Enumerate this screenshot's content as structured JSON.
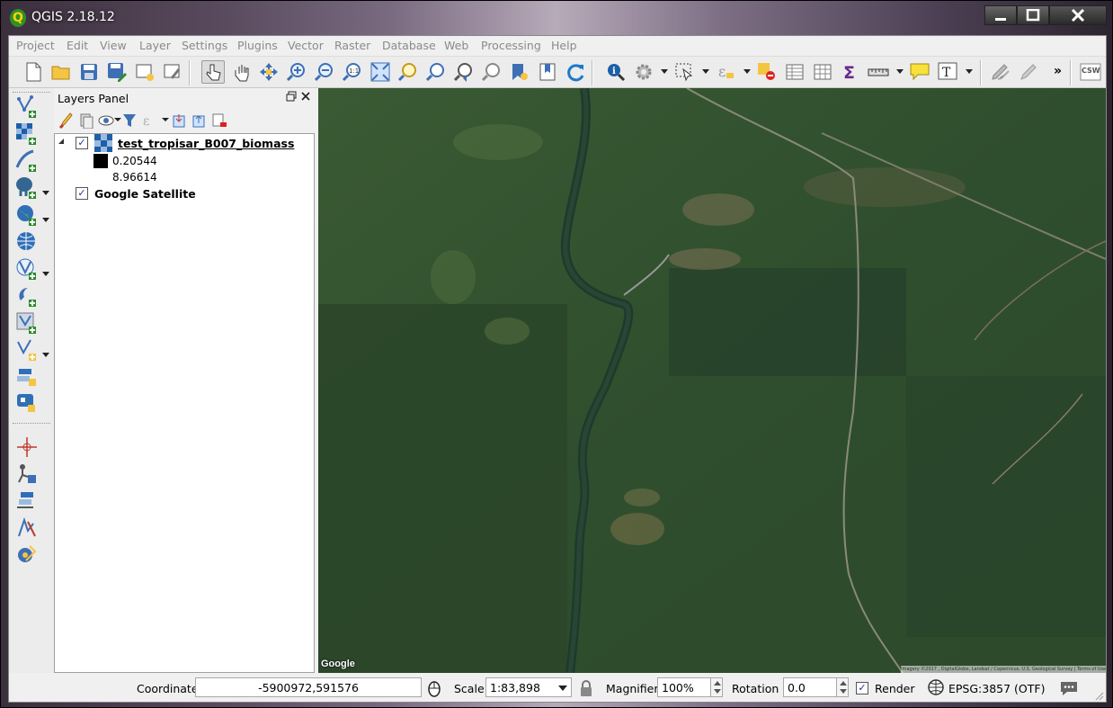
{
  "window": {
    "title": "QGIS 2.18.12",
    "app_icon_letter": "Q"
  },
  "menubar": {
    "items": [
      "Project",
      "Edit",
      "View",
      "Layer",
      "Settings",
      "Plugins",
      "Vector",
      "Raster",
      "Database",
      "Web",
      "Processing",
      "Help"
    ]
  },
  "toolbar": {
    "overflow": "»",
    "csw_label": "CSW"
  },
  "layers_panel": {
    "title": "Layers Panel",
    "layers": [
      {
        "name": "test_tropisar_B007_biomass",
        "checked": true,
        "legend": [
          {
            "label": "0.20544",
            "color": "#000000"
          },
          {
            "label": "8.96614",
            "color": "#ffffff"
          }
        ]
      },
      {
        "name": "Google Satellite",
        "checked": true
      }
    ]
  },
  "map": {
    "watermark": "Google",
    "attribution": "Imagery ©2017 , DigitalGlobe, Landsat / Copernicus, U.S. Geological Survey | Terms of Use"
  },
  "statusbar": {
    "coordinate_label": "Coordinate",
    "coordinate_value": "-5900972,591576",
    "scale_label": "Scale",
    "scale_value": "1:83,898",
    "magnifier_label": "Magnifier",
    "magnifier_value": "100%",
    "rotation_label": "Rotation",
    "rotation_value": "0.0",
    "render_label": "Render",
    "render_checked": true,
    "crs_label": "EPSG:3857 (OTF)"
  }
}
